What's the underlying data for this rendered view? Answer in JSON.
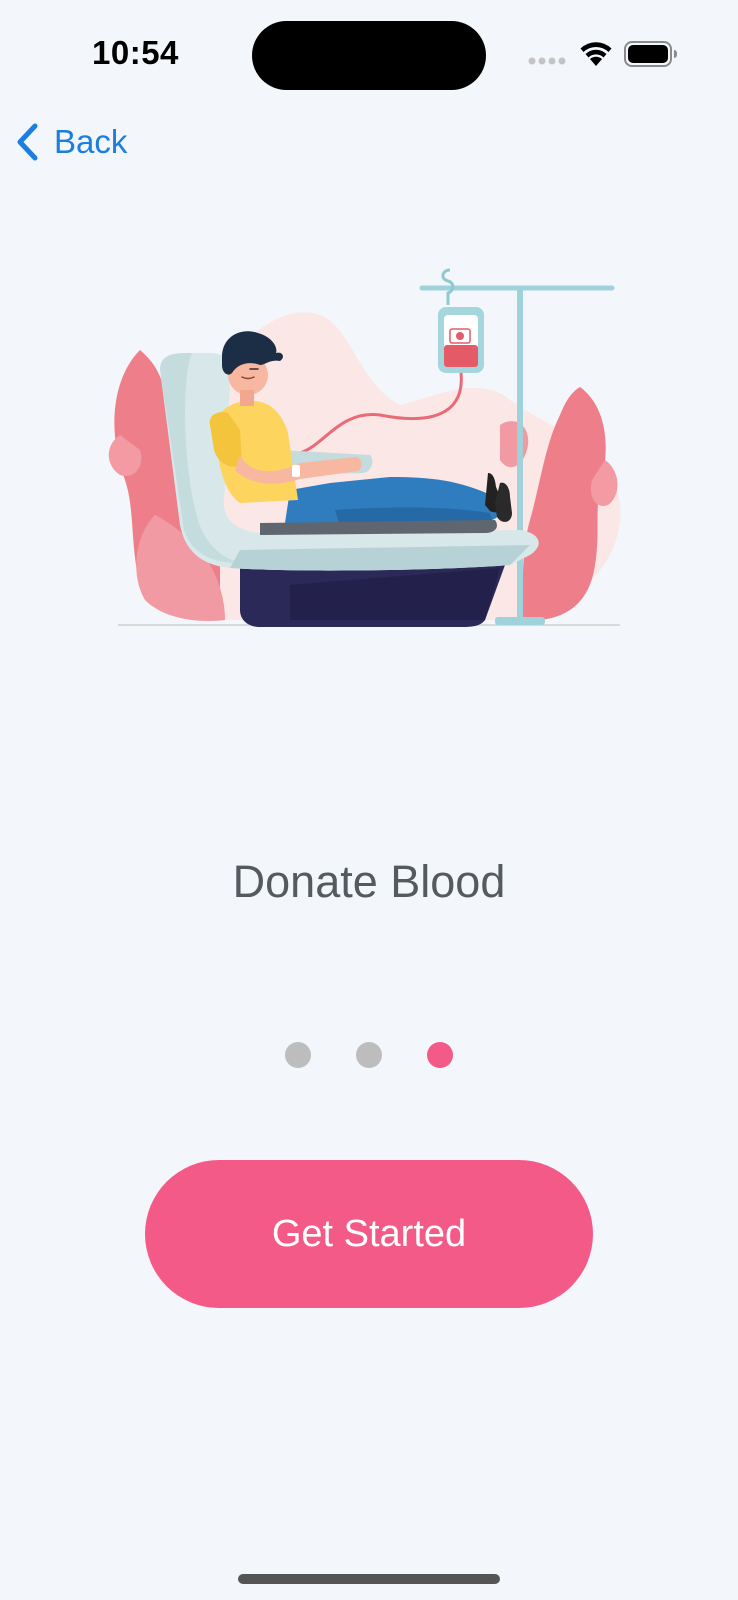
{
  "status_bar": {
    "time": "10:54"
  },
  "nav": {
    "back_label": "Back"
  },
  "onboarding": {
    "title": "Donate Blood",
    "page_count": 3,
    "active_page": 3
  },
  "cta": {
    "label": "Get Started"
  },
  "colors": {
    "accent": "#f45a87",
    "link": "#1a7fe0",
    "background": "#f3f6fa",
    "title": "#555a5f",
    "dot_inactive": "#bdbdbd"
  },
  "icons": {
    "back": "chevron-left-icon",
    "signal": "cellular-signal-icon",
    "wifi": "wifi-icon",
    "battery": "battery-icon",
    "illustration": "blood-donation-illustration"
  }
}
